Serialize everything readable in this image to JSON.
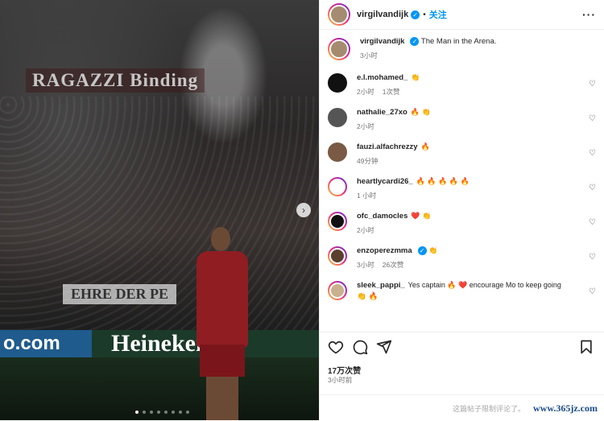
{
  "photo": {
    "banner_top": "RAGAZZI  Binding",
    "banner_mid": "EHRE DER  PE",
    "ad_left": "o.com",
    "ad_mid": "Heineken",
    "carousel_next": "›"
  },
  "post": {
    "header": {
      "username": "virgilvandijk",
      "follow_label": "关注",
      "more_label": "···"
    },
    "caption": {
      "username": "virgilvandijk",
      "text": "The Man in the Arena.",
      "time": "3小时"
    },
    "comments": [
      {
        "username": "e.l.mohamed_",
        "text": "👏",
        "time": "2小时",
        "likes": "1次赞"
      },
      {
        "username": "nathalie_27xo",
        "text": "🔥 👏",
        "time": "2小时",
        "likes": ""
      },
      {
        "username": "fauzi.alfachrezzy",
        "text": "🔥",
        "time": "49分钟",
        "likes": ""
      },
      {
        "username": "heartlycardi26_",
        "text": "🔥 🔥 🔥 🔥 🔥",
        "time": "1 小时",
        "likes": ""
      },
      {
        "username": "ofc_damocles",
        "text": "❤️ 👏",
        "time": "2小时",
        "likes": ""
      },
      {
        "username": "enzoperezmma",
        "text": "👏",
        "time": "3小时",
        "likes": "26次赞"
      },
      {
        "username": "sleek_pappi_",
        "text": "Yes captain 🔥 ❤️ encourage Mo to keep going",
        "text2": "👏 🔥",
        "time": "",
        "likes": ""
      }
    ],
    "likes_count": "17万次赞",
    "time_ago": "3小时前",
    "comments_limited": "这篇帖子限制评论了。",
    "watermark": "www.365jz.com"
  },
  "icons": [
    "heart-icon",
    "comment-icon",
    "share-icon",
    "save-icon",
    "verified-icon",
    "more-icon"
  ],
  "colors": {
    "accent": "#0095f6",
    "text": "#262626",
    "muted": "#737373"
  }
}
